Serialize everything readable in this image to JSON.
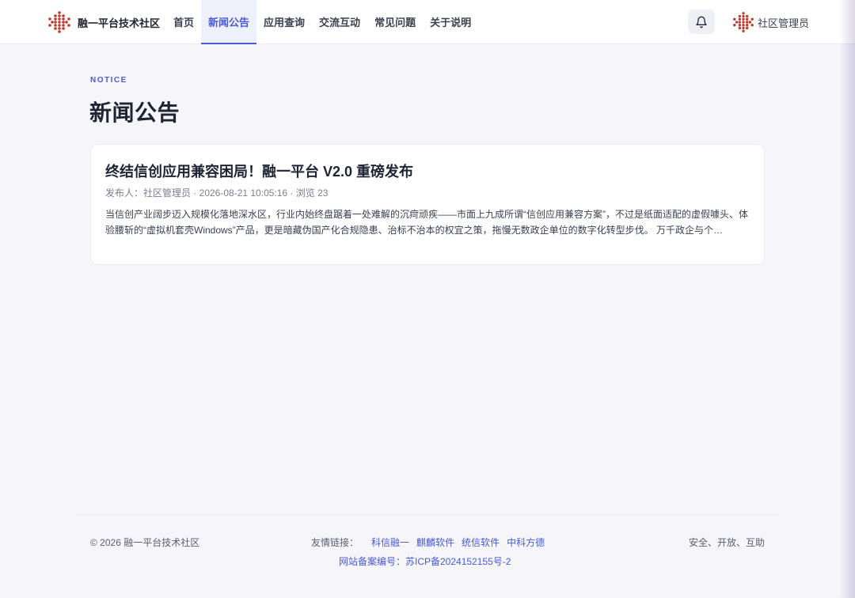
{
  "header": {
    "brand_name": "融一平台技术社区",
    "nav": [
      {
        "label": "首页",
        "active": false
      },
      {
        "label": "新闻公告",
        "active": true
      },
      {
        "label": "应用查询",
        "active": false
      },
      {
        "label": "交流互动",
        "active": false
      },
      {
        "label": "常见问题",
        "active": false
      },
      {
        "label": "关于说明",
        "active": false
      }
    ],
    "bell_icon": "bell-icon",
    "user_name": "社区管理员"
  },
  "main": {
    "section_tag": "NOTICE",
    "title": "新闻公告",
    "posts": [
      {
        "title": "终结信创应用兼容困局！融一平台 V2.0 重磅发布",
        "meta": "发布人：社区管理员 · 2026-08-21 10:05:16 · 浏览 23",
        "excerpt": "当信创产业阔步迈入规模化落地深水区，行业内始终盘踞着一处难解的沉疴顽疾——市面上九成所谓“信创应用兼容方案”，不过是纸面适配的虚假噱头、体验腰斩的“虚拟机套壳Windows”产品，更是暗藏伪国产化合规隐患、治标不治本的权宜之策，拖慢无数政企单位的数字化转型步伐。 万千政企与个…"
      }
    ]
  },
  "footer": {
    "copyright": "© 2026 融一平台技术社区",
    "links_label": "友情链接：",
    "links": [
      "科信融一",
      "麒麟软件",
      "统信软件",
      "中科方德"
    ],
    "icp": "网站备案编号：苏ICP备2024152155号-2",
    "motto": "安全、开放、互助"
  },
  "colors": {
    "accent": "#4a5bd6",
    "brand_red": "#c0392b",
    "page_bg": "#f5f5fa",
    "text_dark": "#1f2433"
  }
}
